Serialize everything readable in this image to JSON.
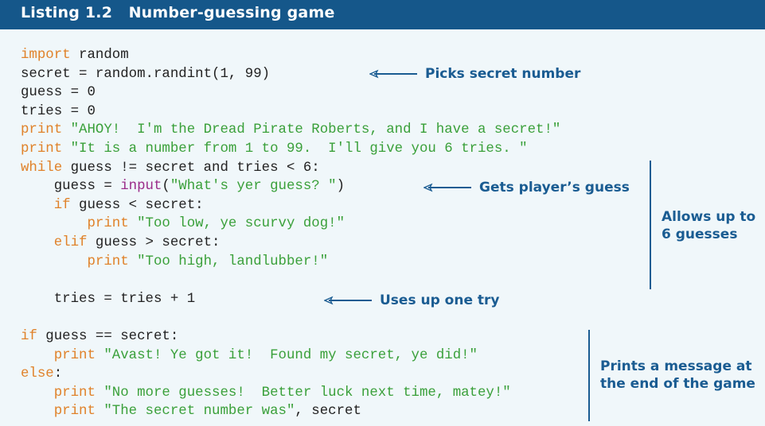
{
  "listing": {
    "number": "Listing 1.2",
    "title": "Number-guessing game"
  },
  "code_lines": [
    [
      {
        "t": "kw",
        "v": "import"
      },
      {
        "t": "n",
        "v": " random"
      }
    ],
    [
      {
        "t": "n",
        "v": "secret = random.randint(1, 99)"
      }
    ],
    [
      {
        "t": "n",
        "v": "guess = 0"
      }
    ],
    [
      {
        "t": "n",
        "v": "tries = 0"
      }
    ],
    [
      {
        "t": "kw",
        "v": "print"
      },
      {
        "t": "str",
        "v": " \"AHOY!  I'm the Dread Pirate Roberts, and I have a secret!\""
      }
    ],
    [
      {
        "t": "kw",
        "v": "print"
      },
      {
        "t": "str",
        "v": " \"It is a number from 1 to 99.  I'll give you 6 tries. \""
      }
    ],
    [
      {
        "t": "kw",
        "v": "while"
      },
      {
        "t": "n",
        "v": " guess != secret and tries < 6:"
      }
    ],
    [
      {
        "t": "n",
        "v": "    guess = "
      },
      {
        "t": "fn",
        "v": "input"
      },
      {
        "t": "n",
        "v": "("
      },
      {
        "t": "str",
        "v": "\"What's yer guess? \""
      },
      {
        "t": "n",
        "v": ")"
      }
    ],
    [
      {
        "t": "n",
        "v": "    "
      },
      {
        "t": "kw",
        "v": "if"
      },
      {
        "t": "n",
        "v": " guess < secret:"
      }
    ],
    [
      {
        "t": "n",
        "v": "        "
      },
      {
        "t": "kw",
        "v": "print"
      },
      {
        "t": "str",
        "v": " \"Too low, ye scurvy dog!\""
      }
    ],
    [
      {
        "t": "n",
        "v": "    "
      },
      {
        "t": "kw",
        "v": "elif"
      },
      {
        "t": "n",
        "v": " guess > secret:"
      }
    ],
    [
      {
        "t": "n",
        "v": "        "
      },
      {
        "t": "kw",
        "v": "print"
      },
      {
        "t": "str",
        "v": " \"Too high, landlubber!\""
      }
    ],
    [
      {
        "t": "n",
        "v": ""
      }
    ],
    [
      {
        "t": "n",
        "v": "    tries = tries + 1"
      }
    ],
    [
      {
        "t": "n",
        "v": ""
      }
    ],
    [
      {
        "t": "kw",
        "v": "if"
      },
      {
        "t": "n",
        "v": " guess == secret:"
      }
    ],
    [
      {
        "t": "n",
        "v": "    "
      },
      {
        "t": "kw",
        "v": "print"
      },
      {
        "t": "str",
        "v": " \"Avast! Ye got it!  Found my secret, ye did!\""
      }
    ],
    [
      {
        "t": "kw",
        "v": "else"
      },
      {
        "t": "n",
        "v": ":"
      }
    ],
    [
      {
        "t": "n",
        "v": "    "
      },
      {
        "t": "kw",
        "v": "print"
      },
      {
        "t": "str",
        "v": " \"No more guesses!  Better luck next time, matey!\""
      }
    ],
    [
      {
        "t": "n",
        "v": "    "
      },
      {
        "t": "kw",
        "v": "print"
      },
      {
        "t": "str",
        "v": " \"The secret number was\""
      },
      {
        "t": "n",
        "v": ", secret"
      }
    ]
  ],
  "annotations": {
    "picks_secret": "Picks secret number",
    "gets_guess": "Gets player’s guess",
    "allows_line1": "Allows up to",
    "allows_line2": "6 guesses",
    "uses_try": "Uses up one try",
    "prints_line1": "Prints a message at",
    "prints_line2": "the end of the game"
  },
  "colors": {
    "header_bg": "#15578a",
    "keyword": "#e0822a",
    "string": "#3aa03a",
    "builtin": "#9b2d8a",
    "annotation": "#1a5c92"
  }
}
